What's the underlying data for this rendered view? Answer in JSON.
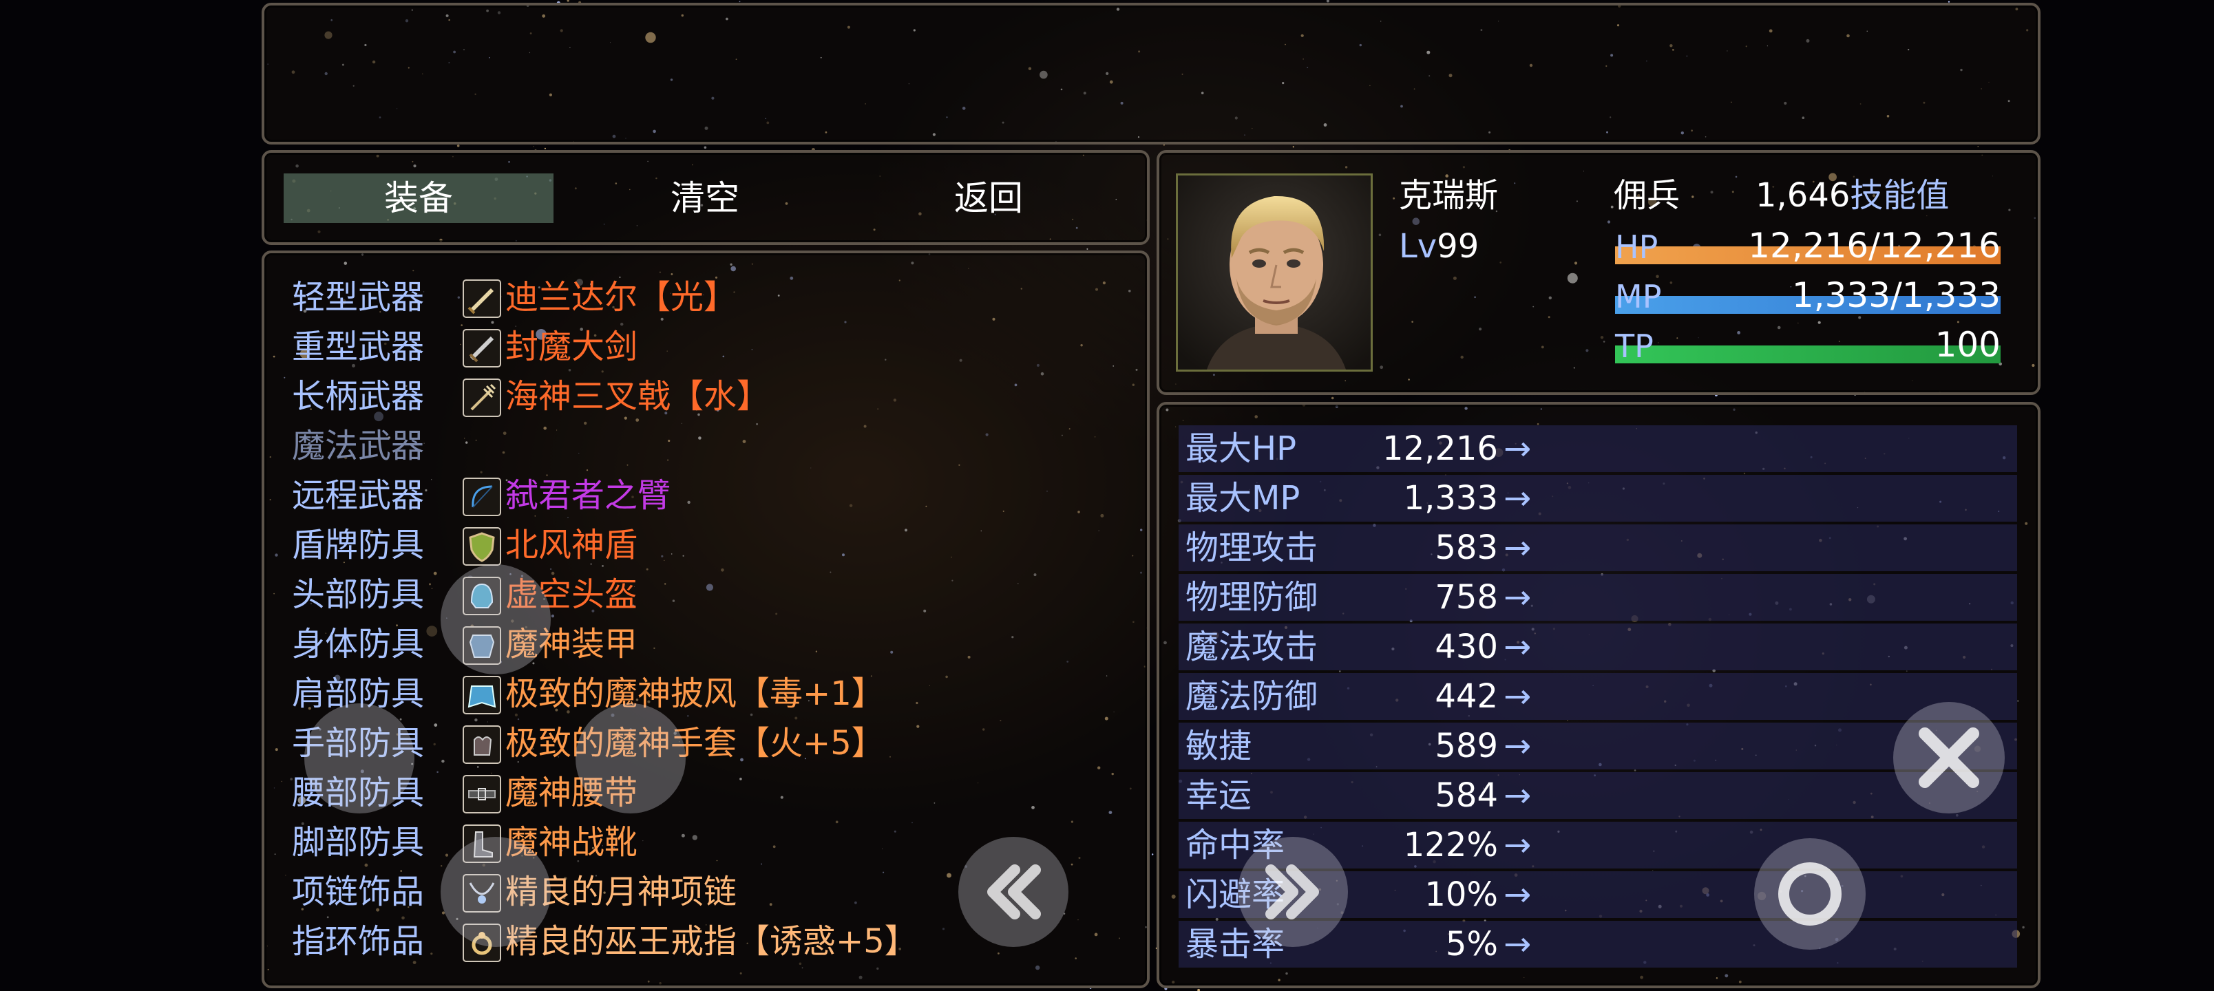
{
  "menu": {
    "equip": "装备",
    "clear": "清空",
    "back": "返回"
  },
  "equipment": [
    {
      "slot": "轻型武器",
      "item": "迪兰达尔【光】",
      "color": "#ff6a2a",
      "icon": "sword-icon"
    },
    {
      "slot": "重型武器",
      "item": "封魔大剑",
      "color": "#ff6a2a",
      "icon": "greatsword-icon"
    },
    {
      "slot": "长柄武器",
      "item": "海神三叉戟【水】",
      "color": "#ff6a2a",
      "icon": "trident-icon"
    },
    {
      "slot": "魔法武器",
      "item": "",
      "color": "#7b87a8",
      "icon": ""
    },
    {
      "slot": "远程武器",
      "item": "弑君者之臂",
      "color": "#c33ae6",
      "icon": "bow-icon"
    },
    {
      "slot": "盾牌防具",
      "item": "北风神盾",
      "color": "#ff6a2a",
      "icon": "shield-icon"
    },
    {
      "slot": "头部防具",
      "item": "虚空头盔",
      "color": "#ff6a2a",
      "icon": "helmet-icon"
    },
    {
      "slot": "身体防具",
      "item": "魔神装甲",
      "color": "#ff9a4a",
      "icon": "armor-icon"
    },
    {
      "slot": "肩部防具",
      "item": "极致的魔神披风【毒+1】",
      "color": "#ff9a4a",
      "icon": "cloak-icon"
    },
    {
      "slot": "手部防具",
      "item": "极致的魔神手套【火+5】",
      "color": "#ff9a4a",
      "icon": "gloves-icon"
    },
    {
      "slot": "腰部防具",
      "item": "魔神腰带",
      "color": "#ff9a4a",
      "icon": "belt-icon"
    },
    {
      "slot": "脚部防具",
      "item": "魔神战靴",
      "color": "#ff9a4a",
      "icon": "boots-icon"
    },
    {
      "slot": "项链饰品",
      "item": "精良的月神项链",
      "color": "#ffb878",
      "icon": "necklace-icon"
    },
    {
      "slot": "指环饰品",
      "item": "精良的巫王戒指【诱惑+5】",
      "color": "#ffb878",
      "icon": "ring-icon"
    }
  ],
  "character": {
    "name": "克瑞斯",
    "class": "佣兵",
    "level_prefix": "Lv",
    "level": "99",
    "skill_points": "1,646",
    "skill_label": "技能值",
    "hp_label": "HP",
    "hp_value": "12,216/12,216",
    "hp_fraction": 1.0,
    "mp_label": "MP",
    "mp_value": "1,333/1,333",
    "mp_fraction": 1.0,
    "tp_label": "TP",
    "tp_value": "100",
    "tp_fraction": 1.0
  },
  "stats": [
    {
      "name": "最大HP",
      "value": "12,216",
      "arrow": "→"
    },
    {
      "name": "最大MP",
      "value": "1,333",
      "arrow": "→"
    },
    {
      "name": "物理攻击",
      "value": "583",
      "arrow": "→"
    },
    {
      "name": "物理防御",
      "value": "758",
      "arrow": "→"
    },
    {
      "name": "魔法攻击",
      "value": "430",
      "arrow": "→"
    },
    {
      "name": "魔法防御",
      "value": "442",
      "arrow": "→"
    },
    {
      "name": "敏捷",
      "value": "589",
      "arrow": "→"
    },
    {
      "name": "幸运",
      "value": "584",
      "arrow": "→"
    },
    {
      "name": "命中率",
      "value": "122%",
      "arrow": "→"
    },
    {
      "name": "闪避率",
      "value": "10%",
      "arrow": "→"
    },
    {
      "name": "暴击率",
      "value": "5%",
      "arrow": "→"
    }
  ],
  "colors": {
    "label_blue": "#a9c3ff",
    "hp_bar": "#e98a3a",
    "mp_bar": "#3f8fe0",
    "tp_bar": "#2fb04c",
    "stat_row_bg": "#282a5a",
    "frame_border": "#5d544a"
  }
}
